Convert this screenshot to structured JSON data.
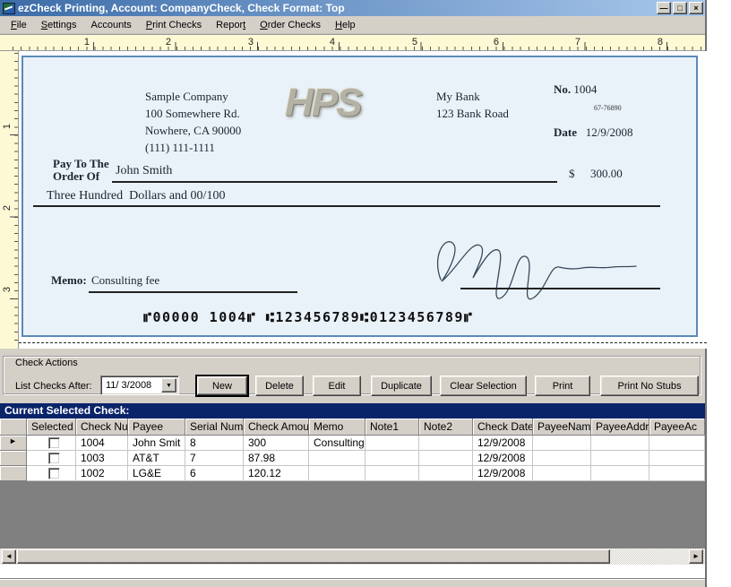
{
  "window": {
    "title": "ezCheck Printing, Account: CompanyCheck, Check Format: Top"
  },
  "icons": {
    "minimize": "—",
    "restore": "□",
    "close": "×",
    "dropdown": "▼",
    "row_marker": "►",
    "scroll_left": "◄",
    "scroll_right": "►"
  },
  "menu": {
    "items": [
      {
        "pre": "",
        "u": "F",
        "post": "ile"
      },
      {
        "pre": "",
        "u": "S",
        "post": "ettings"
      },
      {
        "pre": "Accounts",
        "u": "",
        "post": ""
      },
      {
        "pre": "",
        "u": "P",
        "post": "rint Checks"
      },
      {
        "pre": "Repor",
        "u": "t",
        "post": ""
      },
      {
        "pre": "",
        "u": "O",
        "post": "rder Checks"
      },
      {
        "pre": "",
        "u": "H",
        "post": "elp"
      }
    ]
  },
  "ruler": {
    "h": [
      "1",
      "2",
      "3",
      "4",
      "5",
      "6",
      "7",
      "8"
    ],
    "v": [
      "1",
      "2",
      "3"
    ]
  },
  "check": {
    "company": {
      "name": "Sample Company",
      "address1": "100 Somewhere Rd.",
      "address2": "Nowhere, CA 90000",
      "phone": "(111) 111-1111"
    },
    "logo": "HPS",
    "bank": {
      "name": "My Bank",
      "address": "123 Bank Road"
    },
    "no_label": "No.",
    "no_value": "1004",
    "fraction": "67-76890",
    "date_label": "Date",
    "date_value": "12/9/2008",
    "payto_label1": "Pay To The",
    "payto_label2": "Order Of",
    "payee": "John Smith",
    "dollar_sign": "$",
    "amount": "300.00",
    "amount_words": "Three Hundred  Dollars and 00/100",
    "memo_label": "Memo:",
    "memo_value": "Consulting fee",
    "micr": "⑈00000 1004⑈ ⑆123456789⑆0123456789⑈"
  },
  "actions": {
    "group_title": "Check Actions",
    "list_label": "List Checks After:",
    "date_value": "11/ 3/2008",
    "buttons": [
      "New",
      "Delete",
      "Edit",
      "Duplicate",
      "Clear Selection",
      "Print",
      "Print No Stubs"
    ]
  },
  "grid": {
    "title": "Current Selected Check:",
    "columns": [
      "Selected",
      "Check Nu",
      "Payee",
      "Serial Num",
      "Check Amount",
      "Memo",
      "Note1",
      "Note2",
      "Check Date",
      "PayeeName",
      "PayeeAddre",
      "PayeeAc"
    ],
    "rows": [
      {
        "no": "1004",
        "payee": "John Smit",
        "serial": "8",
        "amount": "300",
        "memo": "Consulting",
        "note1": "",
        "note2": "",
        "date": "12/9/2008",
        "pname": "",
        "paddr": "",
        "pac": ""
      },
      {
        "no": "1003",
        "payee": "AT&T",
        "serial": "7",
        "amount": "87.98",
        "memo": "",
        "note1": "",
        "note2": "",
        "date": "12/9/2008",
        "pname": "",
        "paddr": "",
        "pac": ""
      },
      {
        "no": "1002",
        "payee": "LG&E",
        "serial": "6",
        "amount": "120.12",
        "memo": "",
        "note1": "",
        "note2": "",
        "date": "12/9/2008",
        "pname": "",
        "paddr": "",
        "pac": ""
      }
    ]
  },
  "colors": {
    "titlebar_left": "#3c6ca8",
    "titlebar_right": "#a8c8ec",
    "navy_bar": "#0a246a",
    "chrome": "#d4d0c8",
    "check_bg": "#e9f2f9",
    "check_border": "#5b8ab8",
    "ruler_bg": "#fcf9d4",
    "grid_fill": "#808080"
  }
}
